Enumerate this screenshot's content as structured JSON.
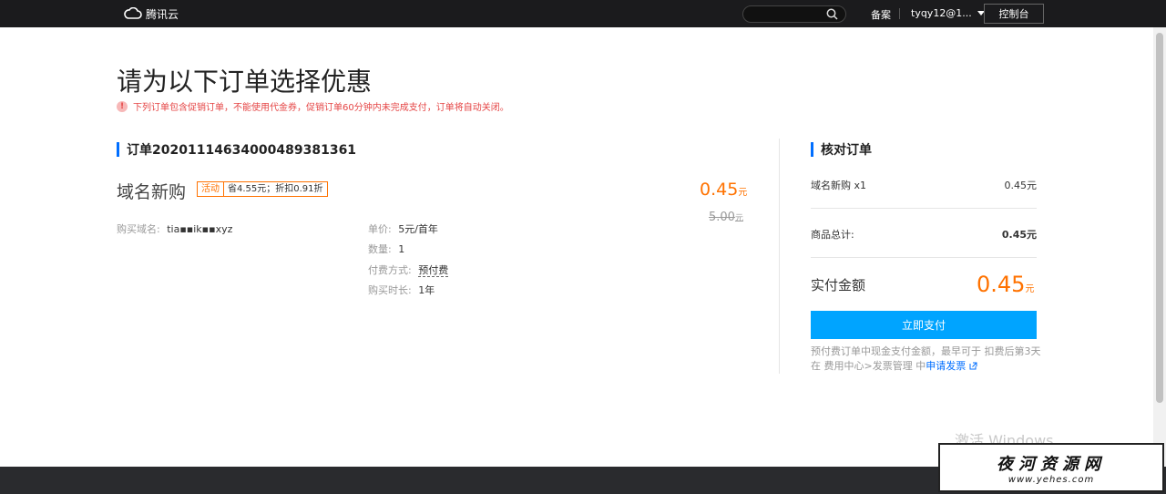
{
  "topbar": {
    "logo_text": "腾讯云",
    "search_placeholder": "",
    "beian": "备案",
    "user": "tyqy12@1...",
    "console": "控制台"
  },
  "page": {
    "title": "请为以下订单选择优惠",
    "notice": "下列订单包含促销订单，不能使用代金券，促销订单60分钟内未完成支付，订单将自动关闭。"
  },
  "order": {
    "id_label": "订单20201114634000489381361",
    "product": "域名新购",
    "promo_tag": "活动",
    "promo_desc": "省4.55元；折扣0.91折",
    "price_now": "0.45",
    "price_unit": "元",
    "price_old": "5.00",
    "domain_label": "购买域名:",
    "domain_value": "tia▪▪ik▪▪xyz",
    "unit_price_label": "单价:",
    "unit_price_value": "5元/首年",
    "qty_label": "数量:",
    "qty_value": "1",
    "pay_type_label": "付费方式:",
    "pay_type_value": "预付费",
    "duration_label": "购买时长:",
    "duration_value": "1年"
  },
  "summary": {
    "title": "核对订单",
    "item_label": "域名新购 x1",
    "item_price": "0.45元",
    "subtotal_label": "商品总计:",
    "subtotal_value": "0.45元",
    "total_label": "实付金额",
    "total_value": "0.45",
    "total_unit": "元",
    "pay_button": "立即支付",
    "note": "预付费订单中现金支付金额，最早可于 扣费后第3天 在 费用中心>发票管理 中",
    "note_link": "申请发票"
  },
  "watermarks": {
    "windows": "激活 Windows",
    "site_cn": "夜河资源网",
    "site_url": "www.yehes.com"
  },
  "colors": {
    "accent": "#006eff",
    "orange": "#ff7200",
    "pay_button": "#00a4ff",
    "topbar": "#1b1b1d"
  }
}
